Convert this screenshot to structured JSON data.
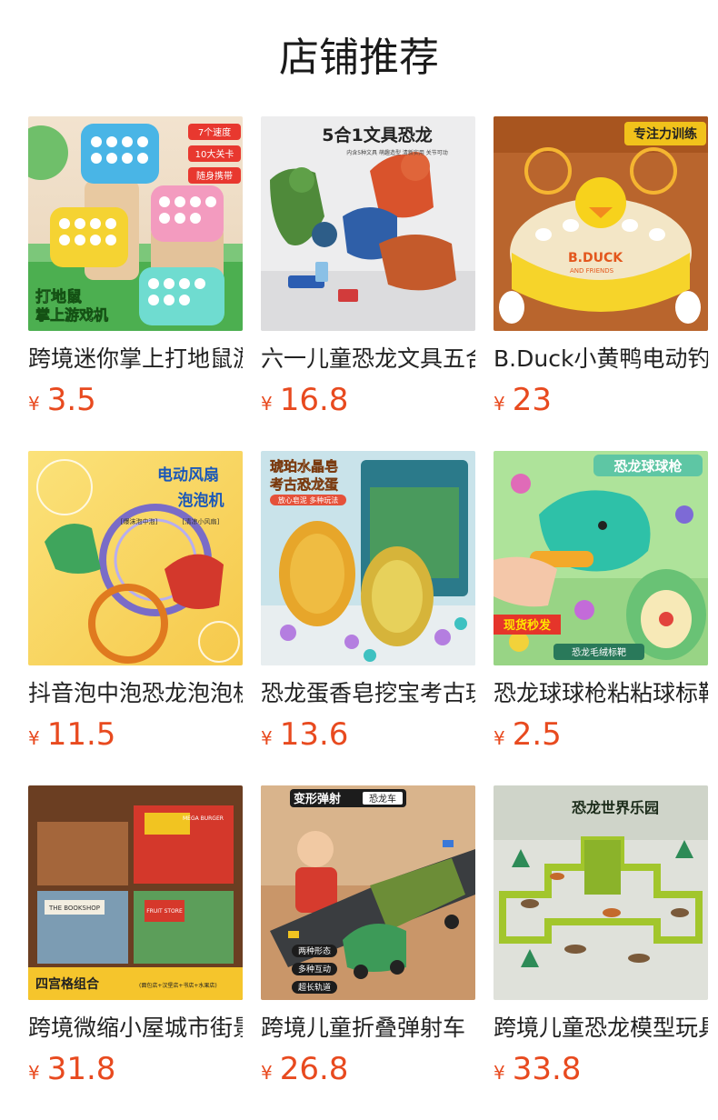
{
  "header": {
    "title": "店铺推荐"
  },
  "currency_symbol": "¥",
  "price_color": "#e84a1f",
  "products": [
    {
      "name": "跨境迷你掌上打地鼠游戏机",
      "price": "3.5",
      "image_icon": "whack-a-mole-toy-image",
      "image_text": [
        "7个速度",
        "10大关卡",
        "随身携带",
        "打地鼠",
        "掌上游戏机"
      ]
    },
    {
      "name": "六一儿童恐龙文具五合一",
      "price": "16.8",
      "image_icon": "dinosaur-stationery-image",
      "image_text": [
        "5合1文具恐龙",
        "内含5种文具 萌趣造型 清新实用 关节可动"
      ]
    },
    {
      "name": "B.Duck小黄鸭电动钓鱼",
      "price": "23",
      "image_icon": "bduck-toy-image",
      "image_text": [
        "专注力训练",
        "B.DUCK",
        "AND FRIENDS"
      ]
    },
    {
      "name": "抖音泡中泡恐龙泡泡机",
      "price": "11.5",
      "image_icon": "bubble-machine-image",
      "image_text": [
        "电动风扇",
        "泡泡机",
        "[爆沫泡中泡]",
        "[清凉小风扇]"
      ]
    },
    {
      "name": "恐龙蛋香皂挖宝考古玩具",
      "price": "13.6",
      "image_icon": "dinosaur-egg-soap-image",
      "image_text": [
        "琥珀水晶皂",
        "考古恐龙蛋",
        "放心皂泥 多种玩法"
      ]
    },
    {
      "name": "恐龙球球枪粘粘球标靶",
      "price": "2.5",
      "image_icon": "dinosaur-ball-gun-image",
      "image_text": [
        "恐龙球球枪",
        "现货秒发",
        "恐龙毛绒标靶"
      ]
    },
    {
      "name": "跨境微缩小屋城市街景",
      "price": "31.8",
      "image_icon": "miniature-house-image",
      "image_text": [
        "四宫格组合",
        "(面包店+汉堡店+书店+水果店)",
        "MEGA BURGER",
        "THE BOOKSHOP",
        "FRUIT STORE"
      ]
    },
    {
      "name": "跨境儿童折叠弹射车",
      "price": "26.8",
      "image_icon": "dinosaur-truck-image",
      "image_text": [
        "变形弹射",
        "恐龙车",
        "两种形态",
        "多种互动",
        "超长轨道"
      ]
    },
    {
      "name": "跨境儿童恐龙模型玩具",
      "price": "33.8",
      "image_icon": "dinosaur-park-image",
      "image_text": [
        "恐龙世界乐园"
      ]
    }
  ]
}
